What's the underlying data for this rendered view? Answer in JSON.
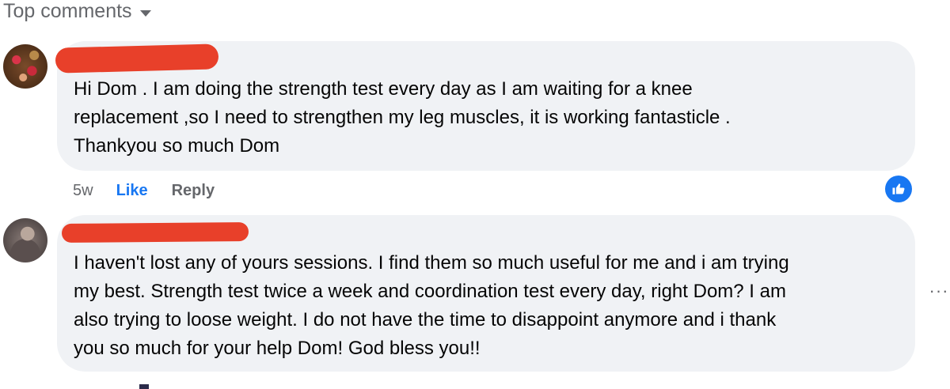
{
  "header": {
    "sort_label": "Top comments",
    "sort_icon": "chevron-down-icon"
  },
  "comments": [
    {
      "avatar": "user-avatar",
      "author_redacted": true,
      "text": "Hi Dom . I am doing the strength test every day as I am waiting for a knee\nreplacement ,so I need to strengthen my leg muscles, it is working fantasticle .\nThankyou so much Dom",
      "time": "5w",
      "like_label": "Like",
      "reply_label": "Reply",
      "reaction": "like-icon"
    },
    {
      "avatar": "user-avatar",
      "author_redacted": true,
      "text": "I haven't lost any of yours sessions. I find them so much useful for me and i am trying\nmy best. Strength test twice a week and coordination test every day, right Dom? I am\nalso trying to loose weight. I do not have the time to disappoint anymore and i thank\nyou so much for your help Dom! God bless you!!",
      "more_options": "···"
    }
  ],
  "colors": {
    "bubble": "#f0f2f5",
    "link_blue": "#1877f2",
    "secondary_text": "#65676b",
    "redaction": "#e8402a"
  }
}
